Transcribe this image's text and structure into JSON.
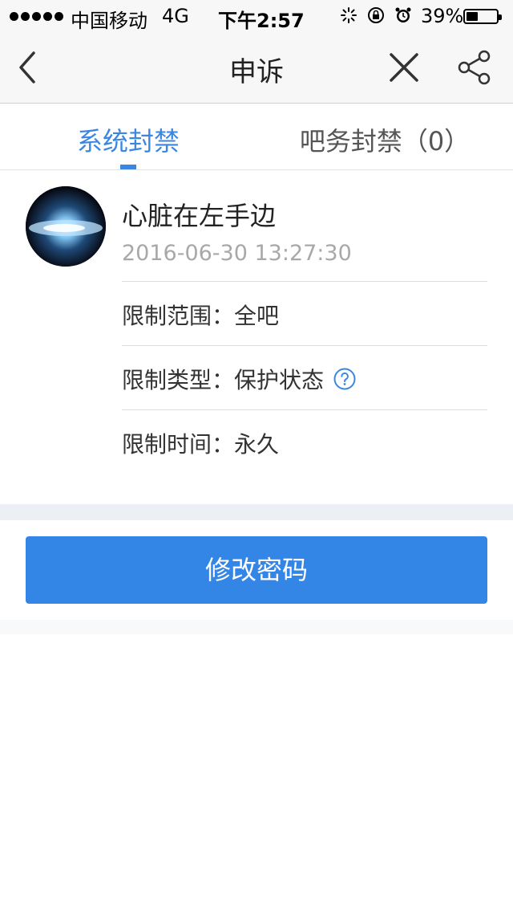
{
  "status_bar": {
    "carrier": "中国移动",
    "network": "4G",
    "time": "下午2:57",
    "battery": "39%",
    "battery_level": 0.39,
    "icons": [
      "activity-spinner-icon",
      "rotation-lock-icon",
      "alarm-icon"
    ]
  },
  "nav": {
    "title": "申诉",
    "back_icon": "chevron-left-icon",
    "close_icon": "close-icon",
    "share_icon": "share-icon"
  },
  "tabs": [
    {
      "label": "系统封禁",
      "active": true
    },
    {
      "label": "吧务封禁（0）",
      "active": false
    }
  ],
  "record": {
    "username": "心脏在左手边",
    "timestamp": "2016-06-30 13:27:30",
    "rows": [
      {
        "label": "限制范围：",
        "value": "全吧"
      },
      {
        "label": "限制类型：",
        "value": "保护状态",
        "help_icon": "question-circle-icon"
      },
      {
        "label": "限制时间：",
        "value": "永久"
      }
    ]
  },
  "action": {
    "button_label": "修改密码"
  },
  "colors": {
    "accent": "#3b86e0",
    "button": "#3385e6",
    "muted_text": "#a8a8a8",
    "separator": "#eceff3"
  }
}
